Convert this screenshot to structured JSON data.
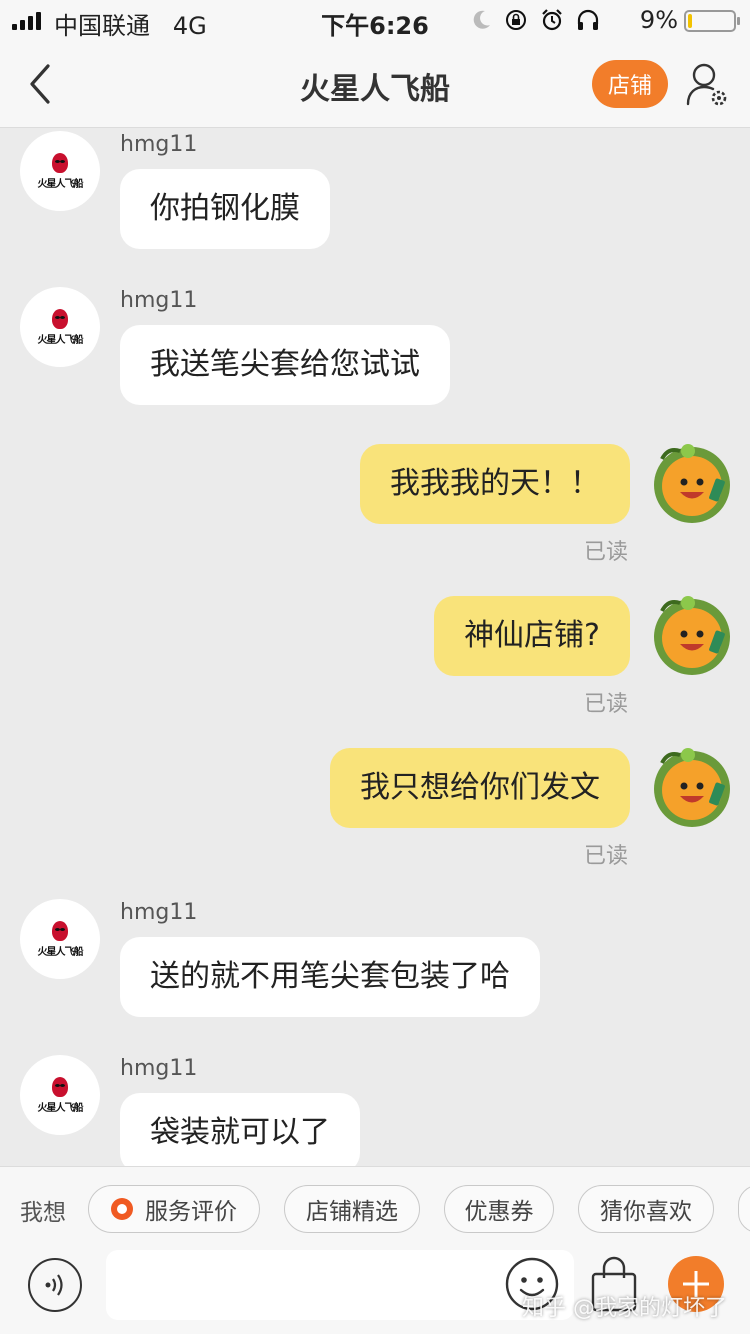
{
  "status_bar": {
    "carrier": "中国联通",
    "network": "4G",
    "time": "下午6:26",
    "battery_text": "9%",
    "battery_level": 0.09,
    "icons": [
      "moon-icon",
      "rotation-lock-icon",
      "alarm-icon",
      "headphones-icon"
    ]
  },
  "nav": {
    "title": "火星人飞船",
    "shop_label": "店铺",
    "back_icon": "chevron-left-icon",
    "user_icon": "user-settings-icon"
  },
  "shop_avatar_text": "火星人飞船",
  "messages": [
    {
      "direction": "in",
      "sender": "hmg11",
      "text": "你拍钢化膜"
    },
    {
      "direction": "in",
      "sender": "hmg11",
      "text": "我送笔尖套给您试试"
    },
    {
      "direction": "out",
      "text": "我我我的天！！",
      "status": "已读"
    },
    {
      "direction": "out",
      "text": "神仙店铺?",
      "status": "已读"
    },
    {
      "direction": "out",
      "text": "我只想给你们发文",
      "status": "已读"
    },
    {
      "direction": "in",
      "sender": "hmg11",
      "text": "送的就不用笔尖套包装了哈"
    },
    {
      "direction": "in",
      "sender": "hmg11",
      "text": "袋装就可以了"
    }
  ],
  "suggestions": {
    "label": "我想",
    "chips": [
      "服务评价",
      "店铺精选",
      "优惠券",
      "猜你喜欢"
    ]
  },
  "input_bar": {
    "value": "",
    "icons": [
      "voice-icon",
      "emoji-icon",
      "shopping-bag-icon",
      "plus-icon"
    ]
  },
  "watermark": "知乎 @我家的灯坏了",
  "colors": {
    "accent_orange": "#f27d2a",
    "outgoing_bubble": "#f9e37a",
    "incoming_bubble": "#ffffff",
    "background": "#ebebeb"
  }
}
